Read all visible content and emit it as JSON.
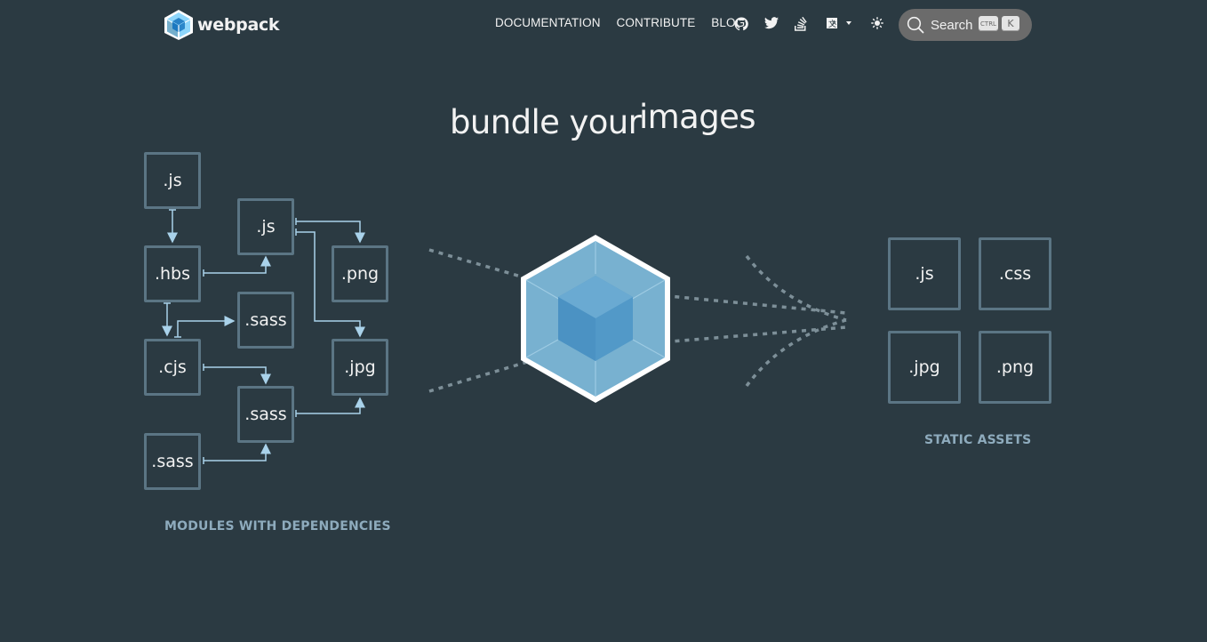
{
  "header": {
    "logo_text": "webpack",
    "nav": {
      "documentation": "DOCUMENTATION",
      "contribute": "CONTRIBUTE",
      "blog": "BLOG"
    },
    "icons": [
      "github-icon",
      "twitter-icon",
      "stack-overflow-icon",
      "language-icon",
      "theme-toggle-icon",
      "search-icon"
    ],
    "search": {
      "label": "Search",
      "kbd_ctrl": "CTRL",
      "kbd_k": "K"
    }
  },
  "hero": {
    "headline": "bundle your",
    "headline_word": "images"
  },
  "modules": {
    "caption": "MODULES WITH DEPENDENCIES",
    "items": [
      ".js",
      ".hbs",
      ".cjs",
      ".sass",
      ".js",
      ".sass",
      ".sass",
      ".png",
      ".jpg"
    ]
  },
  "assets": {
    "caption": "STATIC ASSETS",
    "items": [
      ".js",
      ".css",
      ".jpg",
      ".png"
    ]
  },
  "colors": {
    "background": "#2b3a42",
    "box_border": "#5b7584",
    "arrow": "#a9d2ea",
    "caption": "#8eabbd",
    "cube_light": "#8ed6fb",
    "cube_dark": "#1c78c0"
  }
}
